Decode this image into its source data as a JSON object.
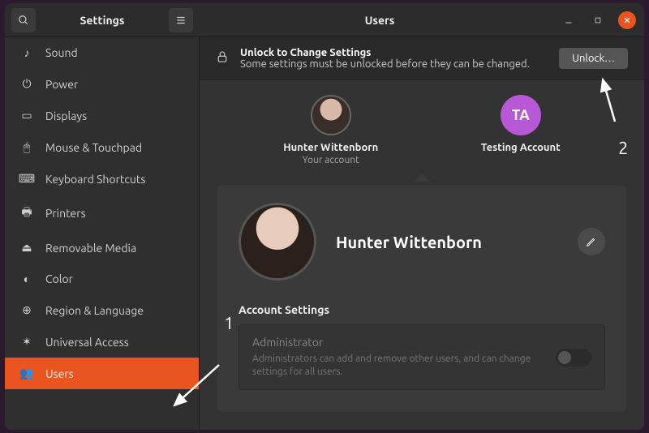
{
  "titlebar": {
    "app_title": "Settings",
    "page_title": "Users"
  },
  "sidebar": {
    "items": [
      {
        "icon": "♪",
        "label": "Sound"
      },
      {
        "icon": "⏻",
        "label": "Power"
      },
      {
        "icon": "▭",
        "label": "Displays"
      },
      {
        "icon": "🖱",
        "label": "Mouse & Touchpad"
      },
      {
        "icon": "⌨",
        "label": "Keyboard Shortcuts"
      },
      {
        "icon": "🖶",
        "label": "Printers"
      },
      {
        "icon": "⏏",
        "label": "Removable Media"
      },
      {
        "icon": "◐",
        "label": "Color"
      },
      {
        "icon": "⊕",
        "label": "Region & Language"
      },
      {
        "icon": "✶",
        "label": "Universal Access"
      },
      {
        "icon": "👥",
        "label": "Users"
      }
    ],
    "active_index": 10
  },
  "unlock": {
    "title": "Unlock to Change Settings",
    "subtitle": "Some settings must be unlocked before they can be changed.",
    "button": "Unlock…"
  },
  "accounts": [
    {
      "name": "Hunter Wittenborn",
      "sub": "Your account",
      "avatar_kind": "photo"
    },
    {
      "name": "Testing Account",
      "sub": "",
      "avatar_kind": "initials",
      "initials": "TA"
    }
  ],
  "profile": {
    "name": "Hunter Wittenborn"
  },
  "section": {
    "title": "Account Settings",
    "admin_title": "Administrator",
    "admin_desc": "Administrators can add and remove other users, and can change settings for all users."
  },
  "annotations": {
    "one": "1",
    "two": "2"
  }
}
